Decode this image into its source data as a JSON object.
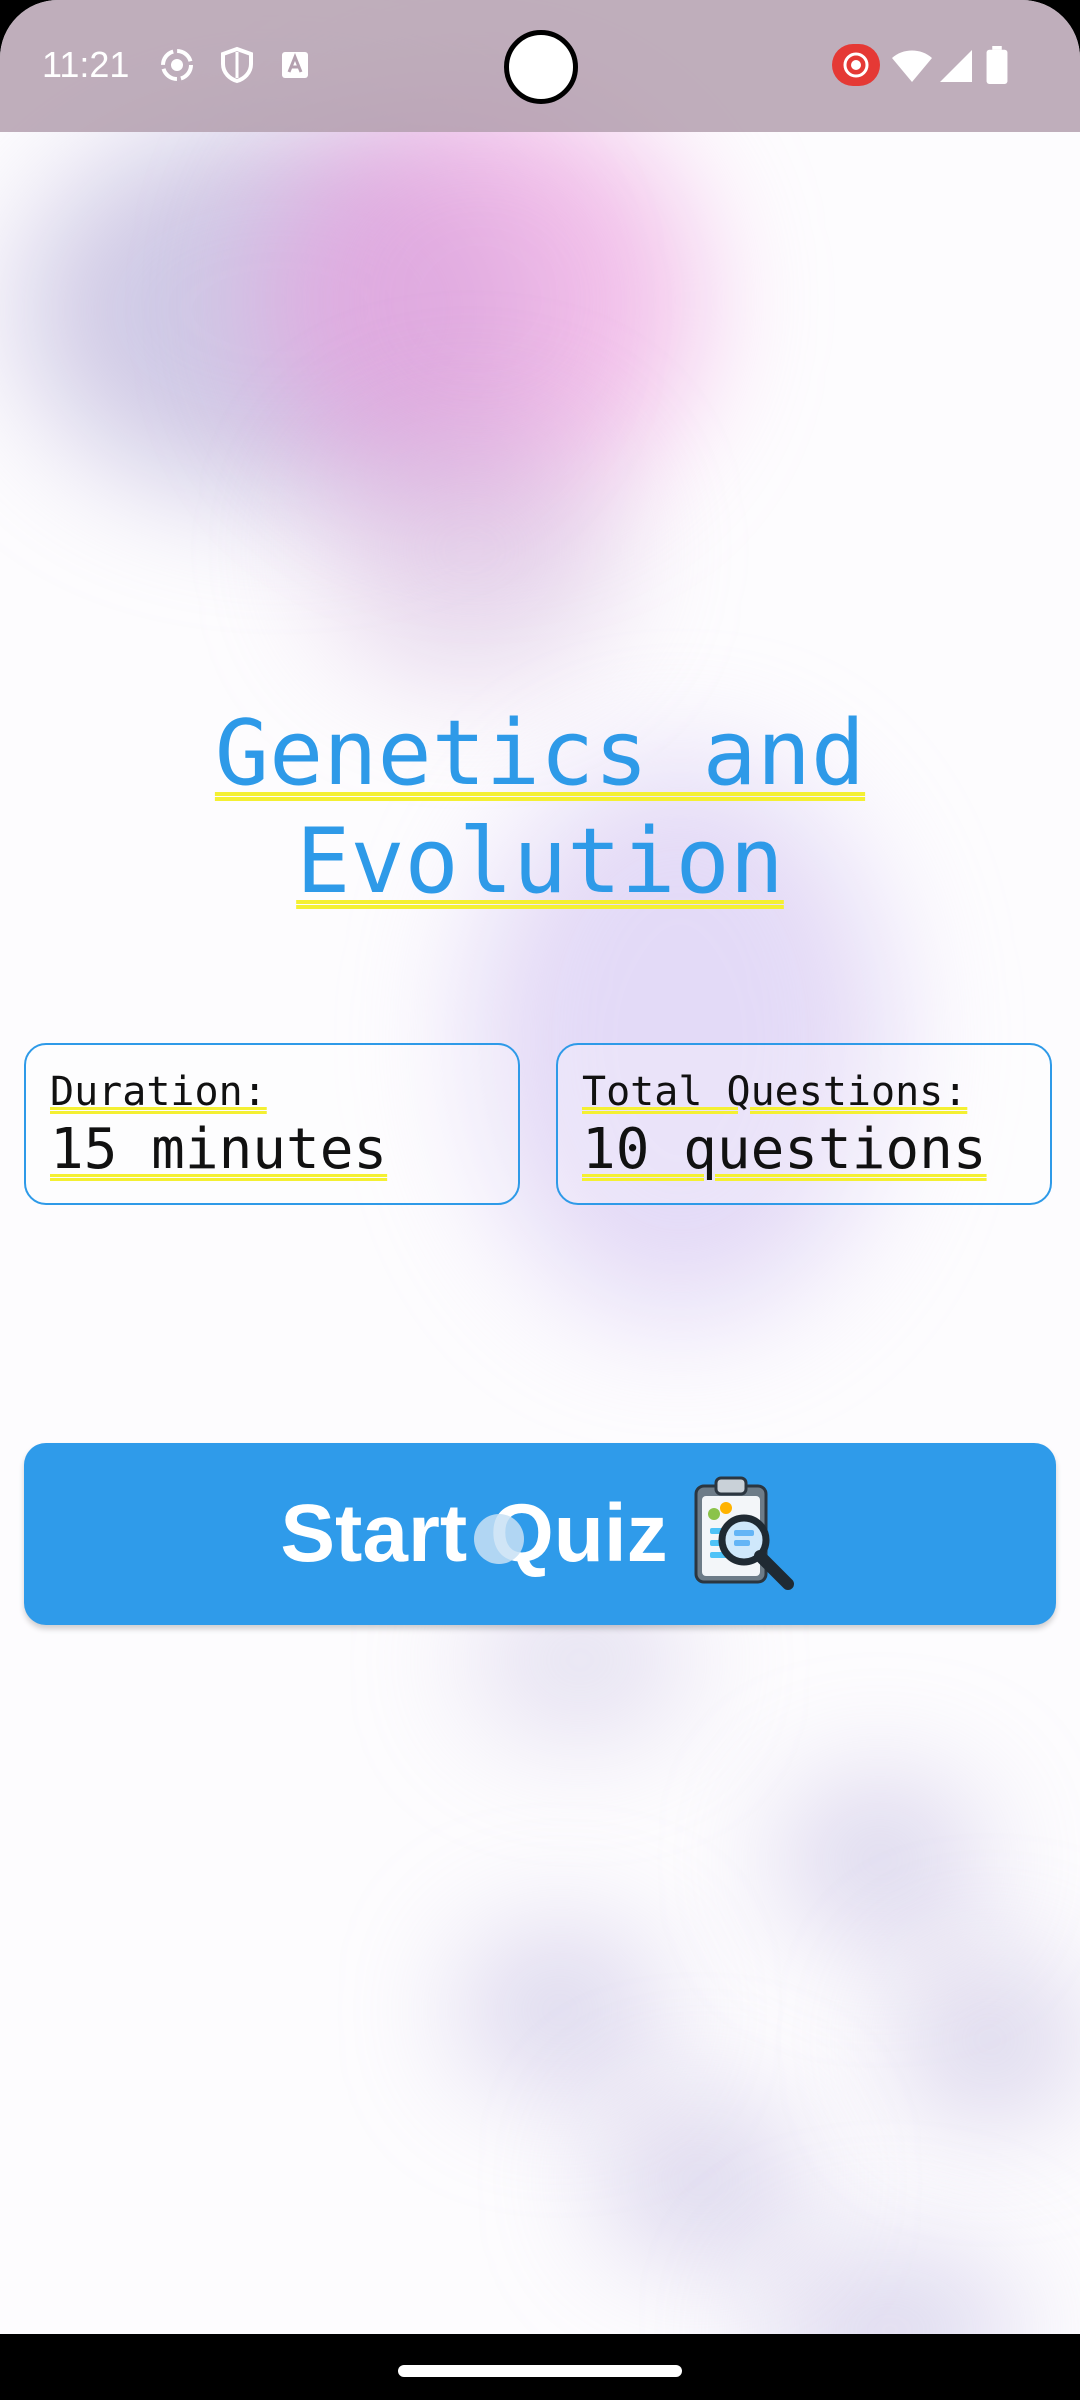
{
  "status_bar": {
    "time": "11:21"
  },
  "quiz": {
    "title_line1": "Genetics and",
    "title_line2": "Evolution",
    "duration_label": "Duration:",
    "duration_value": "15 minutes",
    "questions_label": "Total Questions:",
    "questions_value": "10 questions",
    "start_button_label": "Start Quiz"
  },
  "colors": {
    "accent": "#2e9ae8",
    "highlight": "#f4f032"
  },
  "icons": [
    "camera-icon",
    "vpn-shield-icon",
    "text-icon",
    "screen-record-icon",
    "wifi-icon",
    "signal-icon",
    "battery-icon",
    "clipboard-magnifier-icon"
  ]
}
